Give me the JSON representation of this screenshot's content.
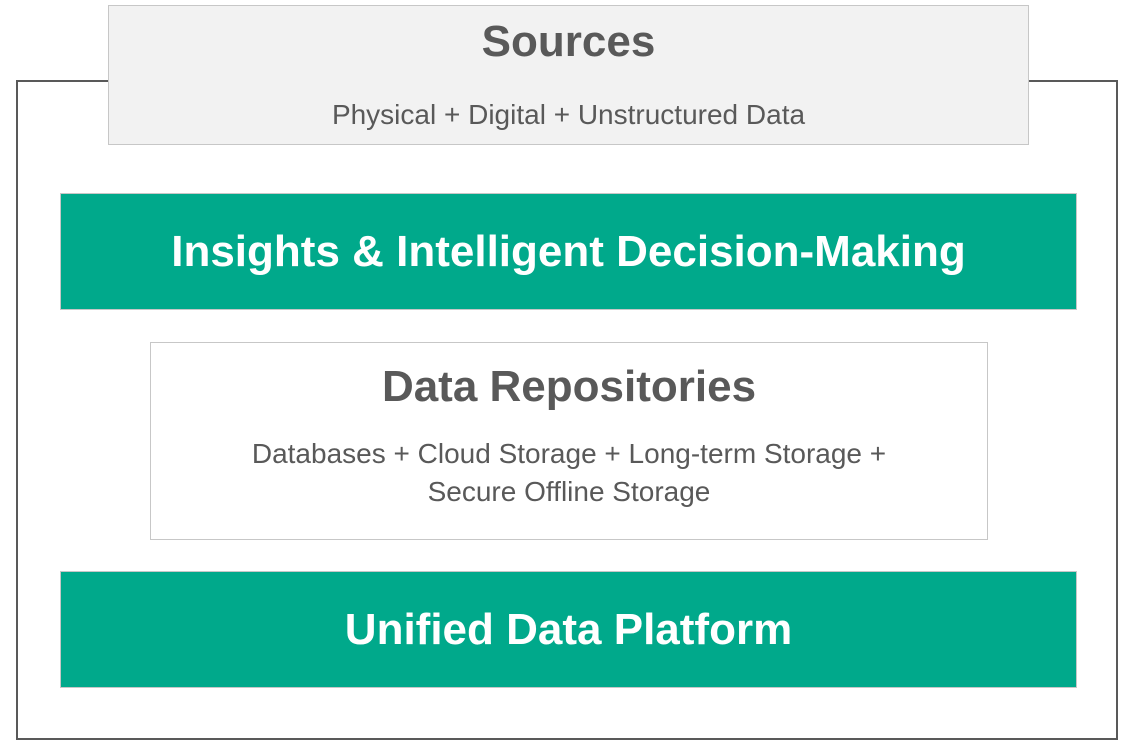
{
  "diagram": {
    "sources": {
      "title": "Sources",
      "subtitle": "Physical + Digital + Unstructured Data"
    },
    "insights": {
      "title": "Insights & Intelligent Decision-Making"
    },
    "repositories": {
      "title": "Data Repositories",
      "subtitle_line1": "Databases + Cloud Storage + Long-term Storage +",
      "subtitle_line2": "Secure Offline Storage"
    },
    "platform": {
      "title": "Unified Data Platform"
    },
    "colors": {
      "accent": "#00a98b",
      "text": "#595959",
      "sources_fill": "#f2f2f2",
      "frame": "#595959"
    }
  }
}
